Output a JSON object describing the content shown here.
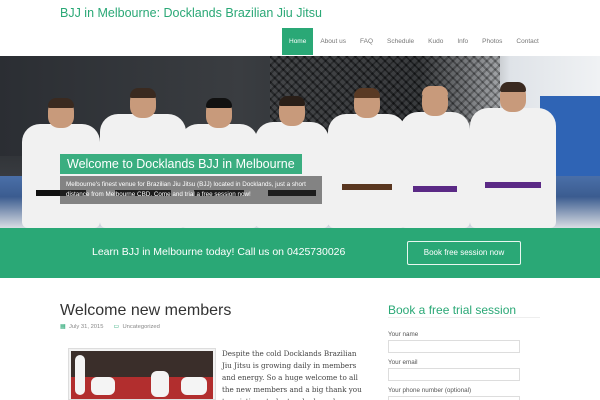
{
  "site": {
    "title": "BJJ in Melbourne: Docklands Brazilian Jiu Jitsu"
  },
  "nav": {
    "items": [
      {
        "label": "Home",
        "active": true
      },
      {
        "label": "About us",
        "active": false
      },
      {
        "label": "FAQ",
        "active": false
      },
      {
        "label": "Schedule",
        "active": false
      },
      {
        "label": "Kudo",
        "active": false
      },
      {
        "label": "Info",
        "active": false
      },
      {
        "label": "Photos",
        "active": false
      },
      {
        "label": "Contact",
        "active": false
      }
    ]
  },
  "hero": {
    "heading": "Welcome to Docklands BJJ in Melbourne",
    "text": "Melbourne's finest venue for Brazilian Jiu Jitsu (BJJ) located in Docklands, just a short distance from Melbourne CBD. Come and trial a free session now!"
  },
  "cta": {
    "text": "Learn BJJ in Melbourne today! Call us on 0425730026",
    "button": "Book free session now"
  },
  "post": {
    "title": "Welcome new members",
    "date": "July 31, 2015",
    "category": "Uncategorized",
    "body": "Despite the cold Docklands Brazilian Jiu Jitsu is growing daily in members and energy. So a huge welcome to all the new members and a big thank you to existing students who have been assisting with"
  },
  "sidebar": {
    "title": "Book a free trial session",
    "fields": [
      {
        "label": "Your name"
      },
      {
        "label": "Your email"
      },
      {
        "label": "Your phone number (optional)"
      }
    ]
  },
  "colors": {
    "accent": "#2aa876"
  }
}
